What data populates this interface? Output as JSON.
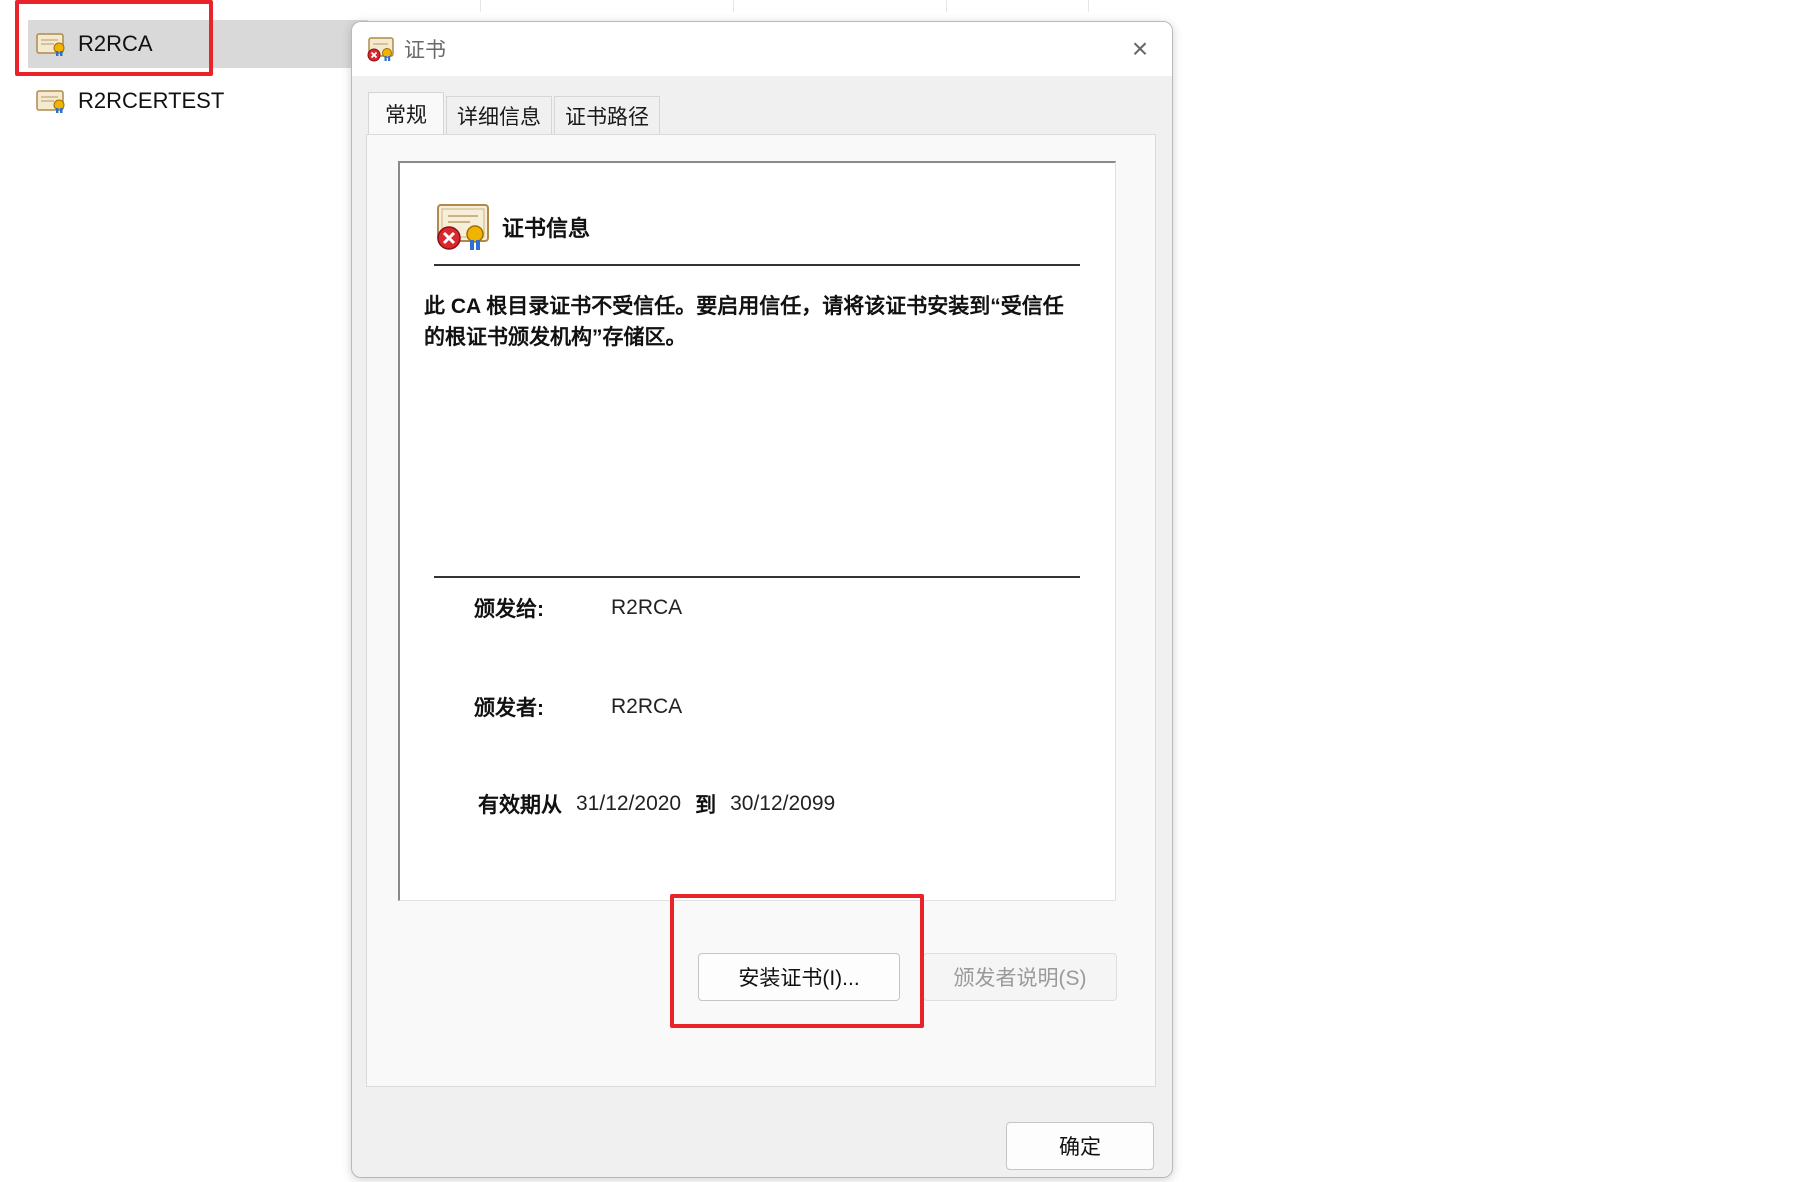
{
  "file_list": {
    "items": [
      {
        "label": "R2RCA",
        "selected": true
      },
      {
        "label": "R2RCERTEST",
        "selected": false
      }
    ]
  },
  "dialog": {
    "title": "证书",
    "close_glyph": "×",
    "tabs": [
      {
        "label": "常规",
        "active": true
      },
      {
        "label": "详细信息",
        "active": false
      },
      {
        "label": "证书路径",
        "active": false
      }
    ],
    "info": {
      "title": "证书信息",
      "warning": "此 CA 根目录证书不受信任。要启用信任，请将该证书安装到“受信任的根证书颁发机构”存储区。",
      "issued_to_label": "颁发给:",
      "issued_to_value": "R2RCA",
      "issued_by_label": "颁发者:",
      "issued_by_value": "R2RCA",
      "valid_from_label": "有效期从",
      "valid_from_value": "31/12/2020",
      "valid_to_label": "到",
      "valid_to_value": "30/12/2099"
    },
    "buttons": {
      "install": "安装证书(I)...",
      "issuer_statement": "颁发者说明(S)",
      "ok": "确定"
    }
  },
  "colors": {
    "highlight_box": "#e8232a",
    "selected_row": "#d9d9d9",
    "dialog_bg": "#f0f0f0"
  }
}
